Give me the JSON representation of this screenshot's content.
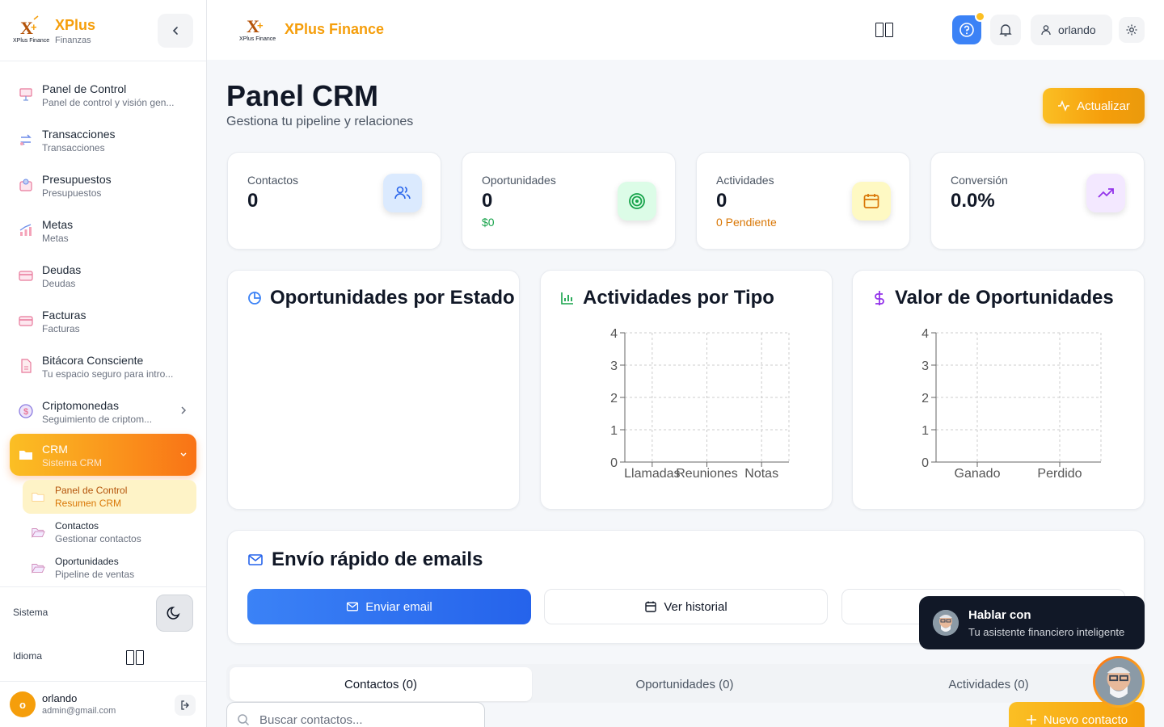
{
  "sidebar": {
    "brand_title": "XPlus",
    "brand_subtitle": "Finanzas",
    "logo_text": "XPlus Finance",
    "items": [
      {
        "label": "Panel de Control",
        "sub": "Panel de control y visión gen..."
      },
      {
        "label": "Transacciones",
        "sub": "Transacciones"
      },
      {
        "label": "Presupuestos",
        "sub": "Presupuestos"
      },
      {
        "label": "Metas",
        "sub": "Metas"
      },
      {
        "label": "Deudas",
        "sub": "Deudas"
      },
      {
        "label": "Facturas",
        "sub": "Facturas"
      },
      {
        "label": "Bitácora Consciente",
        "sub": "Tu espacio seguro para intro..."
      },
      {
        "label": "Criptomonedas",
        "sub": "Seguimiento de criptom..."
      },
      {
        "label": "CRM",
        "sub": "Sistema CRM"
      }
    ],
    "subitems": [
      {
        "label": "Panel de Control",
        "sub": "Resumen CRM"
      },
      {
        "label": "Contactos",
        "sub": "Gestionar contactos"
      },
      {
        "label": "Oportunidades",
        "sub": "Pipeline de ventas"
      }
    ],
    "system_label": "Sistema",
    "language_label": "Idioma",
    "user": {
      "initial": "o",
      "name": "orlando",
      "email": "admin@gmail.com"
    }
  },
  "topbar": {
    "brand": "XPlus Finance",
    "logo_text": "XPlus Finance",
    "username": "orlando"
  },
  "page": {
    "title": "Panel CRM",
    "subtitle": "Gestiona tu pipeline y relaciones",
    "refresh_label": "Actualizar"
  },
  "stats": [
    {
      "label": "Contactos",
      "value": "0",
      "extra": ""
    },
    {
      "label": "Oportunidades",
      "value": "0",
      "extra": "$0"
    },
    {
      "label": "Actividades",
      "value": "0",
      "extra": "0 Pendiente"
    },
    {
      "label": "Conversión",
      "value": "0.0%",
      "extra": ""
    }
  ],
  "colors": {
    "accent": "#f59e0b",
    "blue": "#3b82f6",
    "green": "#16a34a",
    "purple": "#9333ea"
  },
  "chart_data": [
    {
      "type": "pie",
      "title": "Oportunidades por Estado",
      "values": []
    },
    {
      "type": "bar",
      "title": "Actividades por Tipo",
      "categories": [
        "Llamadas",
        "Reuniones",
        "Notas"
      ],
      "values": [
        0,
        0,
        0
      ],
      "ylim": [
        0,
        4
      ],
      "yticks": [
        0,
        1,
        2,
        3,
        4
      ],
      "grid": true
    },
    {
      "type": "bar",
      "title": "Valor de Oportunidades",
      "categories": [
        "Ganado",
        "Perdido"
      ],
      "values": [
        0,
        0
      ],
      "ylim": [
        0,
        4
      ],
      "yticks": [
        0,
        1,
        2,
        3,
        4
      ],
      "grid": true
    }
  ],
  "email": {
    "title": "Envío rápido de emails",
    "send_label": "Enviar email",
    "history_label": "Ver historial"
  },
  "tabs": [
    "Contactos (0)",
    "Oportunidades (0)",
    "Actividades (0)"
  ],
  "search": {
    "placeholder": "Buscar contactos..."
  },
  "new_contact_label": "Nuevo contacto",
  "chat": {
    "title": "Hablar con",
    "subtitle": "Tu asistente financiero inteligente"
  }
}
